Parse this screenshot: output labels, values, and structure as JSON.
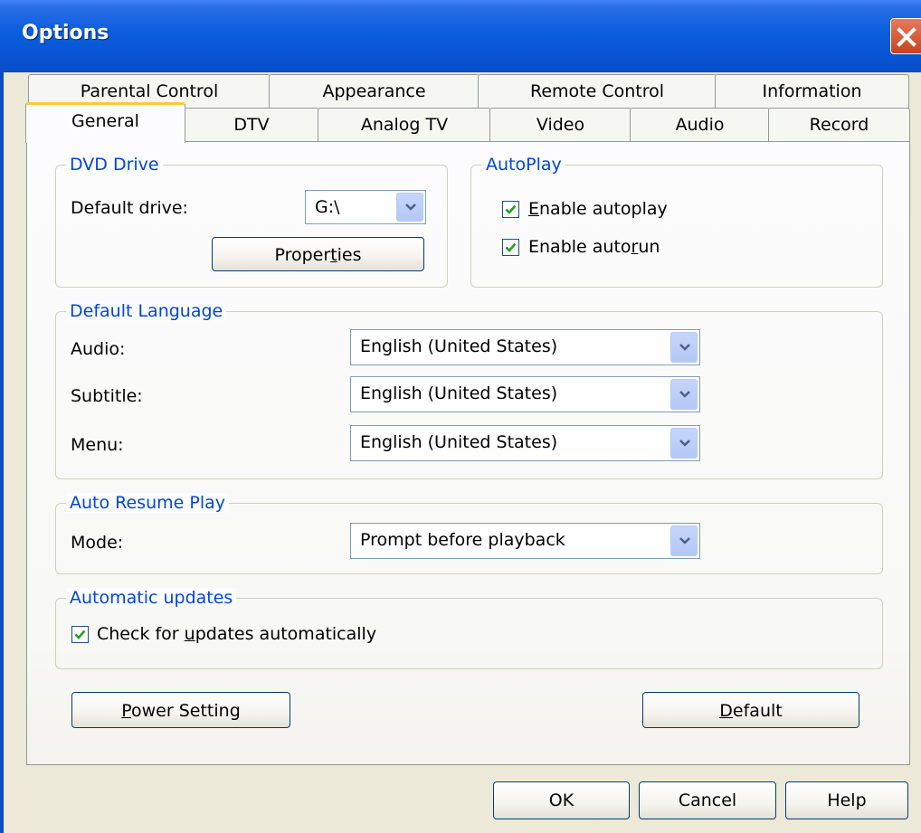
{
  "window": {
    "title": "Options"
  },
  "tabs": {
    "row_back": [
      "Parental Control",
      "Appearance",
      "Remote Control",
      "Information"
    ],
    "row_front": [
      "General",
      "DTV",
      "Analog TV",
      "Video",
      "Audio",
      "Record"
    ],
    "active": "General"
  },
  "dvd_drive": {
    "legend": "DVD Drive",
    "default_drive_label": "Default drive:",
    "default_drive_value": "G:\\",
    "properties_pre": "Proper",
    "properties_u": "t",
    "properties_post": "ies"
  },
  "autoplay": {
    "legend": "AutoPlay",
    "enable_autoplay_u": "E",
    "enable_autoplay_rest": "nable autoplay",
    "enable_autoplay_checked": true,
    "enable_autorun_pre": "Enable auto",
    "enable_autorun_u": "r",
    "enable_autorun_post": "un",
    "enable_autorun_checked": true
  },
  "default_language": {
    "legend": "Default Language",
    "audio_label": "Audio:",
    "audio_value": "English (United States)",
    "subtitle_label": "Subtitle:",
    "subtitle_value": "English (United States)",
    "menu_label": "Menu:",
    "menu_value": "English (United States)"
  },
  "auto_resume": {
    "legend": "Auto Resume Play",
    "mode_label": "Mode:",
    "mode_value": "Prompt before playback"
  },
  "updates": {
    "legend": "Automatic updates",
    "check_pre": "Check for ",
    "check_u": "u",
    "check_post": "pdates automatically",
    "checked": true
  },
  "buttons": {
    "power_u": "P",
    "power_rest": "ower Setting",
    "default_u": "D",
    "default_rest": "efault",
    "ok": "OK",
    "cancel": "Cancel",
    "help": "Help"
  },
  "colors": {
    "titlebar": "#0a5ddc",
    "legend_text": "#0046d5",
    "active_tab_accent": "#ffc83c",
    "checkmark": "#21a121"
  }
}
